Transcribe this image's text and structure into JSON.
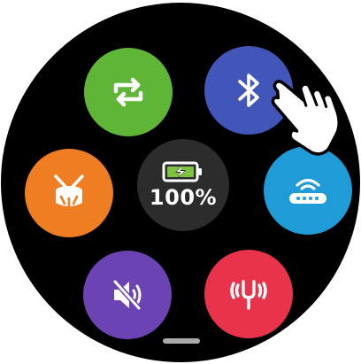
{
  "battery": {
    "percent_label": "100%",
    "level": 1.0,
    "charging": true
  },
  "tiles": [
    {
      "id": "sync",
      "icon": "sync-icon",
      "color": "#5fb536"
    },
    {
      "id": "bluetooth",
      "icon": "bluetooth-icon",
      "color": "#4255b8"
    },
    {
      "id": "drum",
      "icon": "drum-icon",
      "color": "#ef7d22"
    },
    {
      "id": "wifi-router",
      "icon": "router-icon",
      "color": "#1f9bd8"
    },
    {
      "id": "mute",
      "icon": "speaker-muted-icon",
      "color": "#6b43b2"
    },
    {
      "id": "tuning-fork",
      "icon": "tuning-fork-icon",
      "color": "#e8334a"
    }
  ],
  "gesture": {
    "icon": "tap-hand-icon",
    "target": "bluetooth"
  }
}
